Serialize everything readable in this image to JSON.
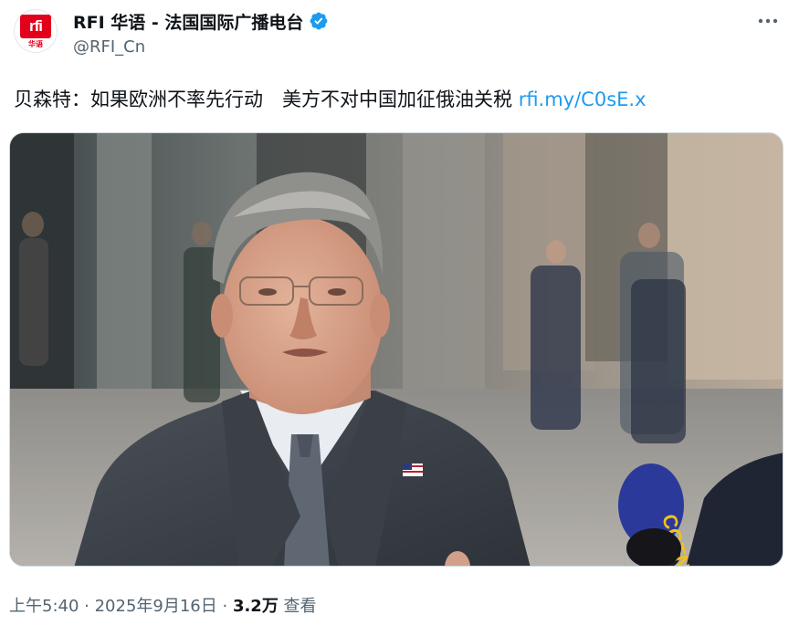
{
  "colors": {
    "brand_red": "#e2001a",
    "link_blue": "#1d9bf0",
    "text_primary": "#0f1419",
    "text_secondary": "#536471",
    "verified_blue": "#1d9bf0"
  },
  "author": {
    "avatar_logo_text": "rfi",
    "avatar_logo_subtext": "华语",
    "display_name": "RFI 华语 - 法国国际广播电台",
    "handle": "@RFI_Cn",
    "verified_icon": "verified-badge-icon"
  },
  "more_icon": "more-horizontal-icon",
  "tweet": {
    "text": "贝森特：如果欧洲不率先行动　美方不对中国加征俄油关税 ",
    "link_text": "rfi.my/C0sE.x"
  },
  "media": {
    "microphone_label": "CGTN"
  },
  "meta": {
    "time": "上午5:40",
    "separator": " · ",
    "date": "2025年9月16日",
    "separator2": " · ",
    "views_count": "3.2万",
    "views_label": " 查看"
  }
}
